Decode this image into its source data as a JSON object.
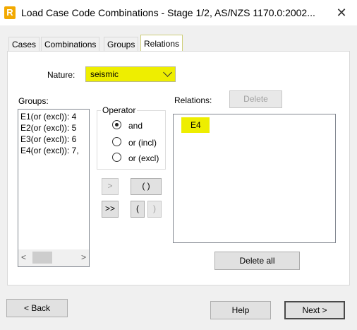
{
  "window": {
    "title": "Load Case Code Combinations - Stage 1/2, AS/NZS 1170.0:2002...",
    "app_icon_letter": "R",
    "close_glyph": "✕"
  },
  "tabs": [
    {
      "label": "Cases"
    },
    {
      "label": "Combinations"
    },
    {
      "label": "Groups"
    },
    {
      "label": "Relations",
      "active": true
    }
  ],
  "nature": {
    "label": "Nature:",
    "value": "seismic"
  },
  "groups": {
    "label": "Groups:",
    "items": [
      "E1(or (excl)): 4",
      "E2(or (excl)): 5",
      "E3(or (excl)): 6",
      "E4(or (excl)): 7,"
    ],
    "scroll_left": "<",
    "scroll_right": ">"
  },
  "operator": {
    "legend": "Operator",
    "options": [
      {
        "label": "and",
        "selected": true
      },
      {
        "label": "or (incl)",
        "selected": false
      },
      {
        "label": "or (excl)",
        "selected": false
      }
    ]
  },
  "buttons": {
    "add": ">",
    "add_all": ">>",
    "parens": "( )",
    "open_paren": "(",
    "close_paren": ")",
    "delete": "Delete",
    "delete_all": "Delete all",
    "back": "< Back",
    "help": "Help",
    "next": "Next >"
  },
  "relations": {
    "label": "Relations:",
    "items": [
      "E4"
    ]
  },
  "colors": {
    "highlight": "#eeee00",
    "app_icon": "#f2a900"
  }
}
